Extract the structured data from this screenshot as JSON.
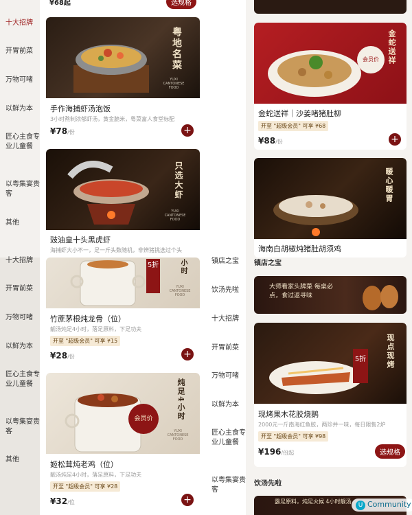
{
  "left": {
    "sidebar_top": [
      {
        "label": "十大招牌",
        "active": true
      },
      {
        "label": "开胃前菜"
      },
      {
        "label": "万物可啫"
      },
      {
        "label": "以鲜为本"
      },
      {
        "label": "匠心主食专业儿童餐"
      },
      {
        "label": "以粤集宴贵客"
      },
      {
        "label": "其他"
      }
    ],
    "sidebar_bottom": [
      {
        "label": "十大招牌"
      },
      {
        "label": "开胃前菜"
      },
      {
        "label": "万物可啫"
      },
      {
        "label": "以鲜为本"
      },
      {
        "label": "匠心主食专业儿童餐"
      },
      {
        "label": "以粤集宴贵客"
      },
      {
        "label": "其他"
      }
    ],
    "top_price": "¥68起",
    "top_button": "选规格",
    "items": [
      {
        "name": "手作海捕虾汤泡饭",
        "desc": "3小时熬制浓郁虾汤，黄金脆米，粤菜富人食堂标配",
        "price": "¥78",
        "unit": "/份",
        "img_text": "粤地名菜",
        "img_brand": "YUXI CANTONESE FOOD"
      },
      {
        "name": "豉油皇十头黑虎虾",
        "desc": "海捕虾大小不一，足一斤头数随机，非辨猪挑选过个头",
        "price": "",
        "unit": "",
        "img_text": "只选大虾",
        "img_brand": "YUXI CANTONESE FOOD"
      },
      {
        "name": "竹蔗茅根炖龙骨（位）",
        "desc": "靓汤炖足4小时，落足原料，下足功夫",
        "badge": "开至 \"超级会员\" 可享 ¥15",
        "price": "¥28",
        "unit": "/份",
        "img_text": "5折",
        "img_text2": "小时",
        "img_brand": "YUXI CANTONESE FOOD"
      },
      {
        "name": "姬松茸炖老鸡（位）",
        "desc": "靓汤炖足4小时，落足原料，下足功夫",
        "badge": "开至 \"超级会员\" 可享 ¥28",
        "price": "¥32",
        "unit": "/位",
        "img_text": "炖足4小时",
        "img_tag": "会员价",
        "img_brand": "YUXI CANTONESE FOOD"
      }
    ]
  },
  "right": {
    "sidebar": [
      {
        "label": "镇店之宝"
      },
      {
        "label": "饮汤先啦"
      },
      {
        "label": "十大招牌"
      },
      {
        "label": "开胃前菜"
      },
      {
        "label": "万物可啫"
      },
      {
        "label": "以鲜为本"
      },
      {
        "label": "匠心主食专业儿童餐"
      },
      {
        "label": "以粤集宴贵客"
      }
    ],
    "section1": "镇店之宝",
    "section2": "饮汤先啦",
    "items": [
      {
        "name": "金蛇送祥｜沙姜啫猪肚柳",
        "badge": "开至 \"超级会员\" 可享 ¥68",
        "price": "¥88",
        "unit": "/份",
        "img_text": "金蛇送祥",
        "img_tag": "会员价"
      },
      {
        "name": "海南白胡椒炖猪肚胡须鸡",
        "desc": "",
        "img_text": "暖心暖胃"
      },
      {
        "banner": "大师看家头牌菜 每桌必点，食过返寻味"
      },
      {
        "name": "现烤果木花胶烧鹅",
        "desc": "2000元一斤南海红鱼胶，两珍并一味，每日限售2炉",
        "badge": "开至 \"超级会员\" 可享 ¥98",
        "price": "¥196",
        "unit": "/份起",
        "button": "选规格",
        "img_text": "现点现烤",
        "img_tag": "5折"
      },
      {
        "banner": "露足原料，炖足火候 4小时靓汤"
      }
    ],
    "watermark": "Community"
  }
}
